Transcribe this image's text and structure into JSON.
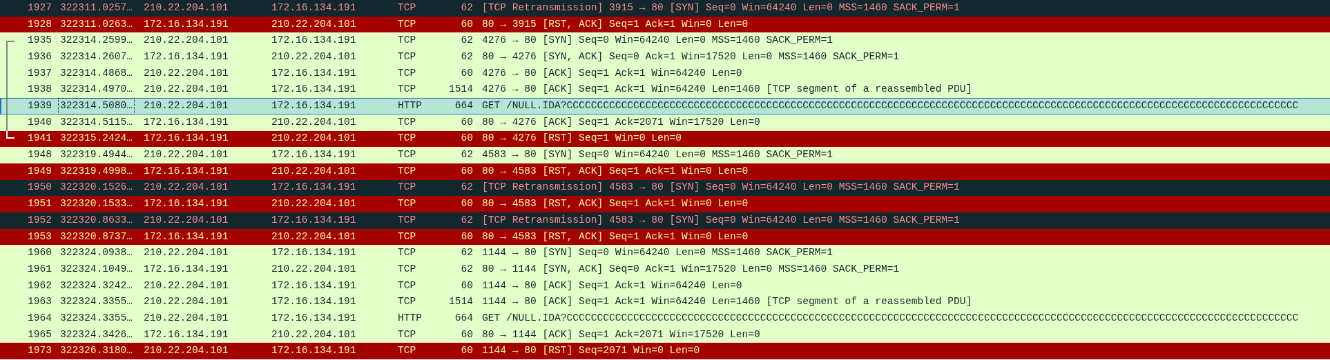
{
  "packets": [
    {
      "no": "1927",
      "time": "322311.0257…",
      "source": "210.22.204.101",
      "destination": "172.16.134.191",
      "protocol": "TCP",
      "length": "62",
      "info": "[TCP Retransmission] 3915 → 80 [SYN] Seq=0 Win=64240 Len=0 MSS=1460 SACK_PERM=1",
      "kind": "retransmission",
      "selected": false,
      "focused": false,
      "related": false
    },
    {
      "no": "1928",
      "time": "322311.0263…",
      "source": "172.16.134.191",
      "destination": "210.22.204.101",
      "protocol": "TCP",
      "length": "60",
      "info": "80 → 3915 [RST, ACK] Seq=1 Ack=1 Win=0 Len=0",
      "kind": "reset",
      "selected": false,
      "focused": false,
      "related": false
    },
    {
      "no": "1935",
      "time": "322314.2599…",
      "source": "210.22.204.101",
      "destination": "172.16.134.191",
      "protocol": "TCP",
      "length": "62",
      "info": "4276 → 80 [SYN] Seq=0 Win=64240 Len=0 MSS=1460 SACK_PERM=1",
      "kind": "normal",
      "selected": false,
      "focused": false,
      "related": true
    },
    {
      "no": "1936",
      "time": "322314.2607…",
      "source": "172.16.134.191",
      "destination": "210.22.204.101",
      "protocol": "TCP",
      "length": "62",
      "info": "80 → 4276 [SYN, ACK] Seq=0 Ack=1 Win=17520 Len=0 MSS=1460 SACK_PERM=1",
      "kind": "normal",
      "selected": false,
      "focused": false,
      "related": true
    },
    {
      "no": "1937",
      "time": "322314.4868…",
      "source": "210.22.204.101",
      "destination": "172.16.134.191",
      "protocol": "TCP",
      "length": "60",
      "info": "4276 → 80 [ACK] Seq=1 Ack=1 Win=64240 Len=0",
      "kind": "normal",
      "selected": false,
      "focused": false,
      "related": true
    },
    {
      "no": "1938",
      "time": "322314.4970…",
      "source": "210.22.204.101",
      "destination": "172.16.134.191",
      "protocol": "TCP",
      "length": "1514",
      "info": "4276 → 80 [ACK] Seq=1 Ack=1 Win=64240 Len=1460 [TCP segment of a reassembled PDU]",
      "kind": "normal",
      "selected": false,
      "focused": false,
      "related": true
    },
    {
      "no": "1939",
      "time": "322314.5080…",
      "source": "210.22.204.101",
      "destination": "172.16.134.191",
      "protocol": "HTTP",
      "length": "664",
      "info": "GET /NULL.IDA?CCCCCCCCCCCCCCCCCCCCCCCCCCCCCCCCCCCCCCCCCCCCCCCCCCCCCCCCCCCCCCCCCCCCCCCCCCCCCCCCCCCCCCCCCCCCCCCCCCCCCCCCCCCCCCCCCCCCCCCCC",
      "kind": "normal",
      "selected": true,
      "focused": true,
      "related": true
    },
    {
      "no": "1940",
      "time": "322314.5115…",
      "source": "172.16.134.191",
      "destination": "210.22.204.101",
      "protocol": "TCP",
      "length": "60",
      "info": "80 → 4276 [ACK] Seq=1 Ack=2071 Win=17520 Len=0",
      "kind": "normal",
      "selected": false,
      "focused": false,
      "related": true
    },
    {
      "no": "1941",
      "time": "322315.2424…",
      "source": "172.16.134.191",
      "destination": "210.22.204.101",
      "protocol": "TCP",
      "length": "60",
      "info": "80 → 4276 [RST] Seq=1 Win=0 Len=0",
      "kind": "reset",
      "selected": false,
      "focused": false,
      "related": true
    },
    {
      "no": "1948",
      "time": "322319.4944…",
      "source": "210.22.204.101",
      "destination": "172.16.134.191",
      "protocol": "TCP",
      "length": "62",
      "info": "4583 → 80 [SYN] Seq=0 Win=64240 Len=0 MSS=1460 SACK_PERM=1",
      "kind": "normal",
      "selected": false,
      "focused": false,
      "related": false
    },
    {
      "no": "1949",
      "time": "322319.4998…",
      "source": "172.16.134.191",
      "destination": "210.22.204.101",
      "protocol": "TCP",
      "length": "60",
      "info": "80 → 4583 [RST, ACK] Seq=1 Ack=1 Win=0 Len=0",
      "kind": "reset",
      "selected": false,
      "focused": false,
      "related": false
    },
    {
      "no": "1950",
      "time": "322320.1526…",
      "source": "210.22.204.101",
      "destination": "172.16.134.191",
      "protocol": "TCP",
      "length": "62",
      "info": "[TCP Retransmission] 4583 → 80 [SYN] Seq=0 Win=64240 Len=0 MSS=1460 SACK_PERM=1",
      "kind": "retransmission",
      "selected": false,
      "focused": false,
      "related": false
    },
    {
      "no": "1951",
      "time": "322320.1533…",
      "source": "172.16.134.191",
      "destination": "210.22.204.101",
      "protocol": "TCP",
      "length": "60",
      "info": "80 → 4583 [RST, ACK] Seq=1 Ack=1 Win=0 Len=0",
      "kind": "reset",
      "selected": false,
      "focused": false,
      "related": false
    },
    {
      "no": "1952",
      "time": "322320.8633…",
      "source": "210.22.204.101",
      "destination": "172.16.134.191",
      "protocol": "TCP",
      "length": "62",
      "info": "[TCP Retransmission] 4583 → 80 [SYN] Seq=0 Win=64240 Len=0 MSS=1460 SACK_PERM=1",
      "kind": "retransmission",
      "selected": false,
      "focused": false,
      "related": false
    },
    {
      "no": "1953",
      "time": "322320.8737…",
      "source": "172.16.134.191",
      "destination": "210.22.204.101",
      "protocol": "TCP",
      "length": "60",
      "info": "80 → 4583 [RST, ACK] Seq=1 Ack=1 Win=0 Len=0",
      "kind": "reset",
      "selected": false,
      "focused": false,
      "related": false
    },
    {
      "no": "1960",
      "time": "322324.0938…",
      "source": "210.22.204.101",
      "destination": "172.16.134.191",
      "protocol": "TCP",
      "length": "62",
      "info": "1144 → 80 [SYN] Seq=0 Win=64240 Len=0 MSS=1460 SACK_PERM=1",
      "kind": "normal",
      "selected": false,
      "focused": false,
      "related": false
    },
    {
      "no": "1961",
      "time": "322324.1049…",
      "source": "172.16.134.191",
      "destination": "210.22.204.101",
      "protocol": "TCP",
      "length": "62",
      "info": "80 → 1144 [SYN, ACK] Seq=0 Ack=1 Win=17520 Len=0 MSS=1460 SACK_PERM=1",
      "kind": "normal",
      "selected": false,
      "focused": false,
      "related": false
    },
    {
      "no": "1962",
      "time": "322324.3242…",
      "source": "210.22.204.101",
      "destination": "172.16.134.191",
      "protocol": "TCP",
      "length": "60",
      "info": "1144 → 80 [ACK] Seq=1 Ack=1 Win=64240 Len=0",
      "kind": "normal",
      "selected": false,
      "focused": false,
      "related": false
    },
    {
      "no": "1963",
      "time": "322324.3355…",
      "source": "210.22.204.101",
      "destination": "172.16.134.191",
      "protocol": "TCP",
      "length": "1514",
      "info": "1144 → 80 [ACK] Seq=1 Ack=1 Win=64240 Len=1460 [TCP segment of a reassembled PDU]",
      "kind": "normal",
      "selected": false,
      "focused": false,
      "related": false
    },
    {
      "no": "1964",
      "time": "322324.3355…",
      "source": "210.22.204.101",
      "destination": "172.16.134.191",
      "protocol": "HTTP",
      "length": "664",
      "info": "GET /NULL.IDA?CCCCCCCCCCCCCCCCCCCCCCCCCCCCCCCCCCCCCCCCCCCCCCCCCCCCCCCCCCCCCCCCCCCCCCCCCCCCCCCCCCCCCCCCCCCCCCCCCCCCCCCCCCCCCCCCCCCCCCCCC",
      "kind": "normal",
      "selected": false,
      "focused": false,
      "related": false
    },
    {
      "no": "1965",
      "time": "322324.3426…",
      "source": "172.16.134.191",
      "destination": "210.22.204.101",
      "protocol": "TCP",
      "length": "60",
      "info": "80 → 1144 [ACK] Seq=1 Ack=2071 Win=17520 Len=0",
      "kind": "normal",
      "selected": false,
      "focused": false,
      "related": false
    },
    {
      "no": "1973",
      "time": "322326.3180…",
      "source": "210.22.204.101",
      "destination": "172.16.134.191",
      "protocol": "TCP",
      "length": "60",
      "info": "1144 → 80 [RST] Seq=2071 Win=0 Len=0",
      "kind": "reset",
      "selected": false,
      "focused": false,
      "related": false
    }
  ]
}
